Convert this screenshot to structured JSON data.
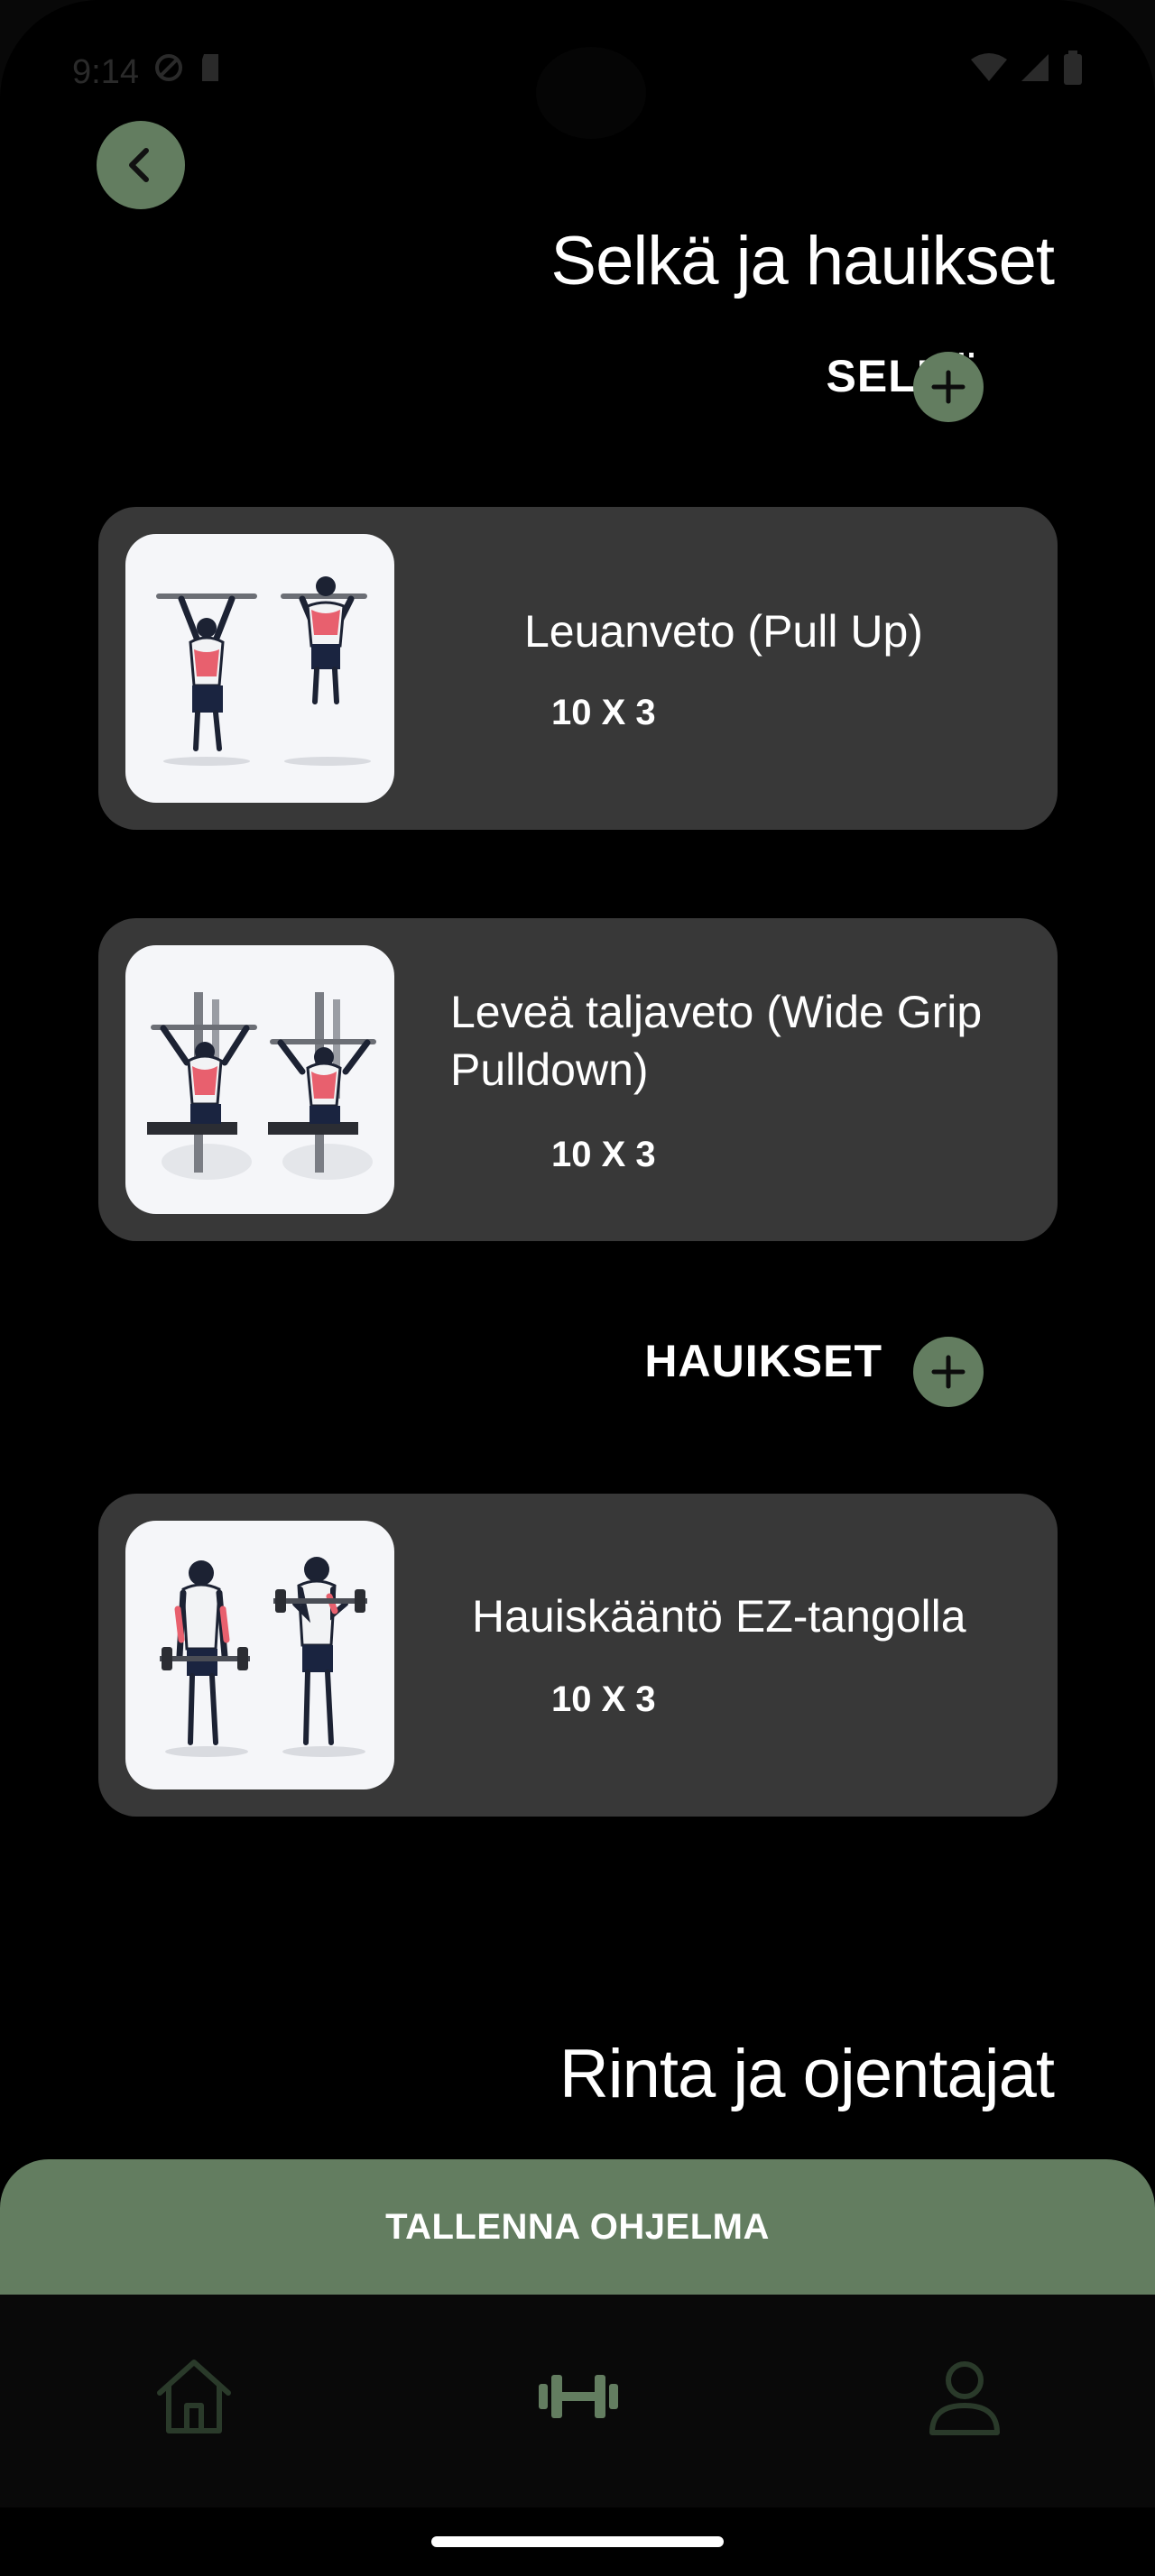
{
  "status_bar": {
    "time": "9:14"
  },
  "header": {
    "back_icon": "chevron-left-icon"
  },
  "program": {
    "title": "Selkä ja hauikset",
    "sections": [
      {
        "label": "SELKÄ",
        "exercises": [
          {
            "name": "Leuanveto (Pull Up)",
            "sets": "10 X 3"
          },
          {
            "name": "Leveä taljaveto (Wide Grip Pulldown)",
            "sets": "10 X 3"
          }
        ]
      },
      {
        "label": "HAUIKSET",
        "exercises": [
          {
            "name": "Hauiskääntö EZ-tangolla",
            "sets": "10 X 3"
          }
        ]
      }
    ]
  },
  "next_program": {
    "title": "Rinta ja ojentajat"
  },
  "save_button": {
    "label": "TALLENNA OHJELMA"
  },
  "bottom_nav": {
    "items": [
      {
        "icon": "home-icon",
        "active": false
      },
      {
        "icon": "dumbbell-icon",
        "active": true
      },
      {
        "icon": "profile-icon",
        "active": false
      }
    ]
  },
  "colors": {
    "accent": "#637d60",
    "card": "#383838",
    "background": "#000000",
    "muscle_highlight": "#e8606e"
  }
}
